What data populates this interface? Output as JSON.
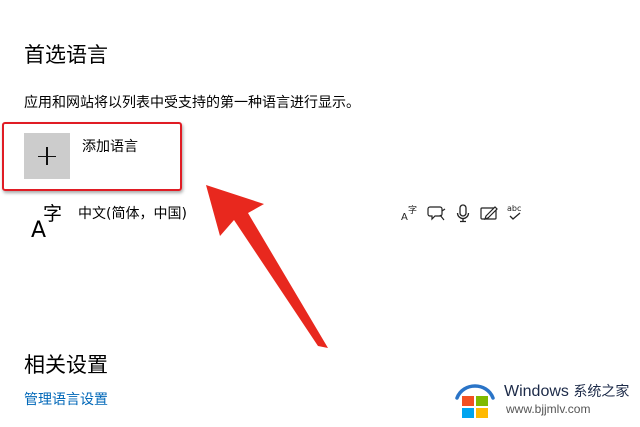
{
  "section_title": "首选语言",
  "description": "应用和网站将以列表中受支持的第一种语言进行显示。",
  "add_language": {
    "label": "添加语言"
  },
  "language_list": [
    {
      "name": "中文(简体，中国)",
      "glyph_a": "A",
      "glyph_zi": "字",
      "features": [
        "display-language-icon",
        "text-to-speech-icon",
        "speech-recognition-icon",
        "handwriting-icon",
        "spell-check-icon"
      ],
      "spell_check_text": "abc"
    }
  ],
  "related_settings": {
    "title": "相关设置",
    "manage_link": "管理语言设置"
  },
  "watermark": {
    "brand": "Windows",
    "brand_cn": "系统之家",
    "url": "www.bjjmlv.com"
  },
  "colors": {
    "highlight": "#e01c24",
    "link": "#0067b8",
    "tile": "#cccccc"
  }
}
